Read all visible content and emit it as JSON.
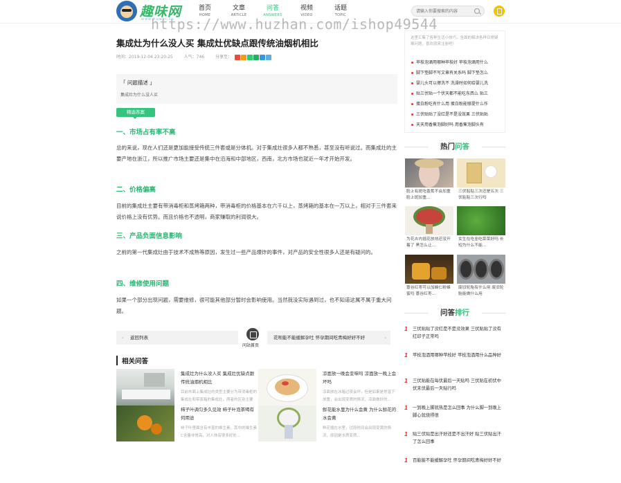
{
  "header": {
    "logo_text": "趣味网",
    "logo_sub": "www.huwei.cn",
    "nav": [
      {
        "cn": "首页",
        "en": "HOME"
      },
      {
        "cn": "文章",
        "en": "ARTICLE"
      },
      {
        "cn": "问答",
        "en": "ANSWERS"
      },
      {
        "cn": "视频",
        "en": "VIDEO"
      },
      {
        "cn": "话题",
        "en": "TOPIC"
      }
    ],
    "search_placeholder": "请输入你要搜索的内容",
    "watermark": "https://www.huzhan.com/ishop49544"
  },
  "article": {
    "title": "集成灶为什么没人买 集成灶优缺点跟传统油烟机相比",
    "time": "时间：2019-12-04 23:20:25",
    "views": "人气：746",
    "share_label": "分享至：",
    "question_label": "「 问题描述 」",
    "question_text": "集成灶为什么没人买",
    "badge": "精选答案",
    "sections": [
      {
        "heading": "一、市场占有率不高",
        "text": "总的来说，现在人们还是更加能接受传统三件套或是分体机。对于集成灶很多人都不熟悉，甚至没有听说过。而集成灶的主要产地在浙江，所以推广市场主要还是集中在沿海和中部地区，西南，北方市场也就近一年才开始开发。"
      },
      {
        "heading": "二、价格偏高",
        "text": "目前的集成灶主要有带消毒柜和蒸烤箱两种，带消毒柜的价格基本在六千以上，蒸烤箱的基本在一万以上，相对于三件套来说价格上没有优势。而且价格也不透明，商家赚取的利润很大。"
      },
      {
        "heading": "三、产品负面信息影响",
        "text": "之前的第一代集成灶由于技术不成熟等原因，发生过一些产品爆炸的事件，对产品的安全性很多人还是有疑问的。"
      },
      {
        "heading": "四、维修使用问题",
        "text": "如果一个部分出现问题，需要维修，很可能其他部分暂时会影响使用。当然我没实际遇到过，也不知道这属不属于重大问题。"
      }
    ],
    "prev": "返回列表",
    "home": "问站首页",
    "next": "花呗能不能缓解孕吐 怀孕期间吃青梅好好不好"
  },
  "related": {
    "heading": "相关问答",
    "items": [
      {
        "title": "集成灶为什么没人买 集成灶优缺点跟传统油烟机相比",
        "desc": "目前市面上集成灶的类型主要分为带消毒柜的集成灶和带蒸箱的集成灶，两者的区别主要是..."
      },
      {
        "title": "凉面放一晚会变味吗 凉面放一晚上会坏吗",
        "desc": "凉面放在冰箱过夜会坏，但是如果是常温下放置，会出现变质的情况，凉面做好的..."
      },
      {
        "title": "柿子叶调匀多久见效 柿子叶泡茶喝有何用途",
        "desc": "柿子叶里面含有丰富的维生素，其中的维生素C含量非常高，对人体有很多好处..."
      },
      {
        "title": "鲜花能水里为什么会黄 为什么鲜花的水会黄",
        "desc": "鲜花插在水里，过段时间会出现变黄的情况，原因是水质变质..."
      }
    ]
  },
  "sidebar": {
    "intro": "这里汇集了各种生活小技巧，全面的解决各种日常疑难问题，喜欢就来注册吧！",
    "list": [
      "苹枝泡酒用哪种苹枝好 苹枝泡酒用什么",
      "脚下垫脚不写文章有关系吗 脚下垫怎么",
      "婴儿头可以擦洗不 洗澡时如何给婴儿洗",
      "贴三伏贴一个伏天都不能吃东西么 贴三",
      "蛋白粉吃有什么用 蛋白粉能够提什么作",
      "三伏贴贴了没红是不是没效果 三伏贴贴",
      "天天用香蕉泡脚好吗 用香蕉泡脚头有"
    ],
    "hot_head": [
      "热门",
      "问答"
    ],
    "hot": [
      "脸上有斑吃香蕉不会加重 脸上斑加重...",
      "三伏贴贴三次还是五次 三伏贴贴三次行吗",
      "为花卉内插花放祛还没开着了 黑怎么让...",
      "女生在吃韭吃菜菜好吗 长短为什么不能...",
      "薏谷红枣可以加蜂仁粉蜂蜜吗 薏谷红枣...",
      "废旧轮胎有什么用 废旧轮胎能做什么用"
    ],
    "rank_head": [
      "问答",
      "排行"
    ],
    "rank": [
      "三伏贴贴了没红是不是没效果 三伏贴贴了没有红印子正常吗",
      "苹枝泡酒用哪种苹枝好 苹枝泡酒用什么品种好",
      "三伏贴能在每伏最后一天贴吗 三伏贴在初伏中伏末伏最后一天贴行吗",
      "一到晚上脚就热是怎么回事 为什么脚一到晚上脚心就烧得很",
      "贴三伏贴是出汗好还是不出汗好 贴三伏贴出汗了怎么回事",
      "百能能不能缓解孕吐 怀孕期间吃青梅好好不好"
    ]
  }
}
